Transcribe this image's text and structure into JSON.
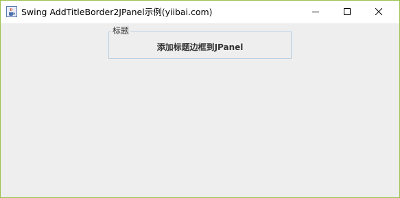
{
  "window": {
    "title": "Swing AddTitleBorder2JPanel示例(yiibai.com)",
    "app_icon": "java-cup-icon",
    "controls": {
      "minimize_icon": "minimize-icon",
      "maximize_icon": "maximize-icon",
      "close_icon": "close-icon"
    },
    "border_color": "#9ac24a"
  },
  "panel": {
    "border_title": "标题",
    "label": "添加标题边框到JPanel",
    "border_color": "#b8cfe5",
    "background": "#eeeeee"
  }
}
